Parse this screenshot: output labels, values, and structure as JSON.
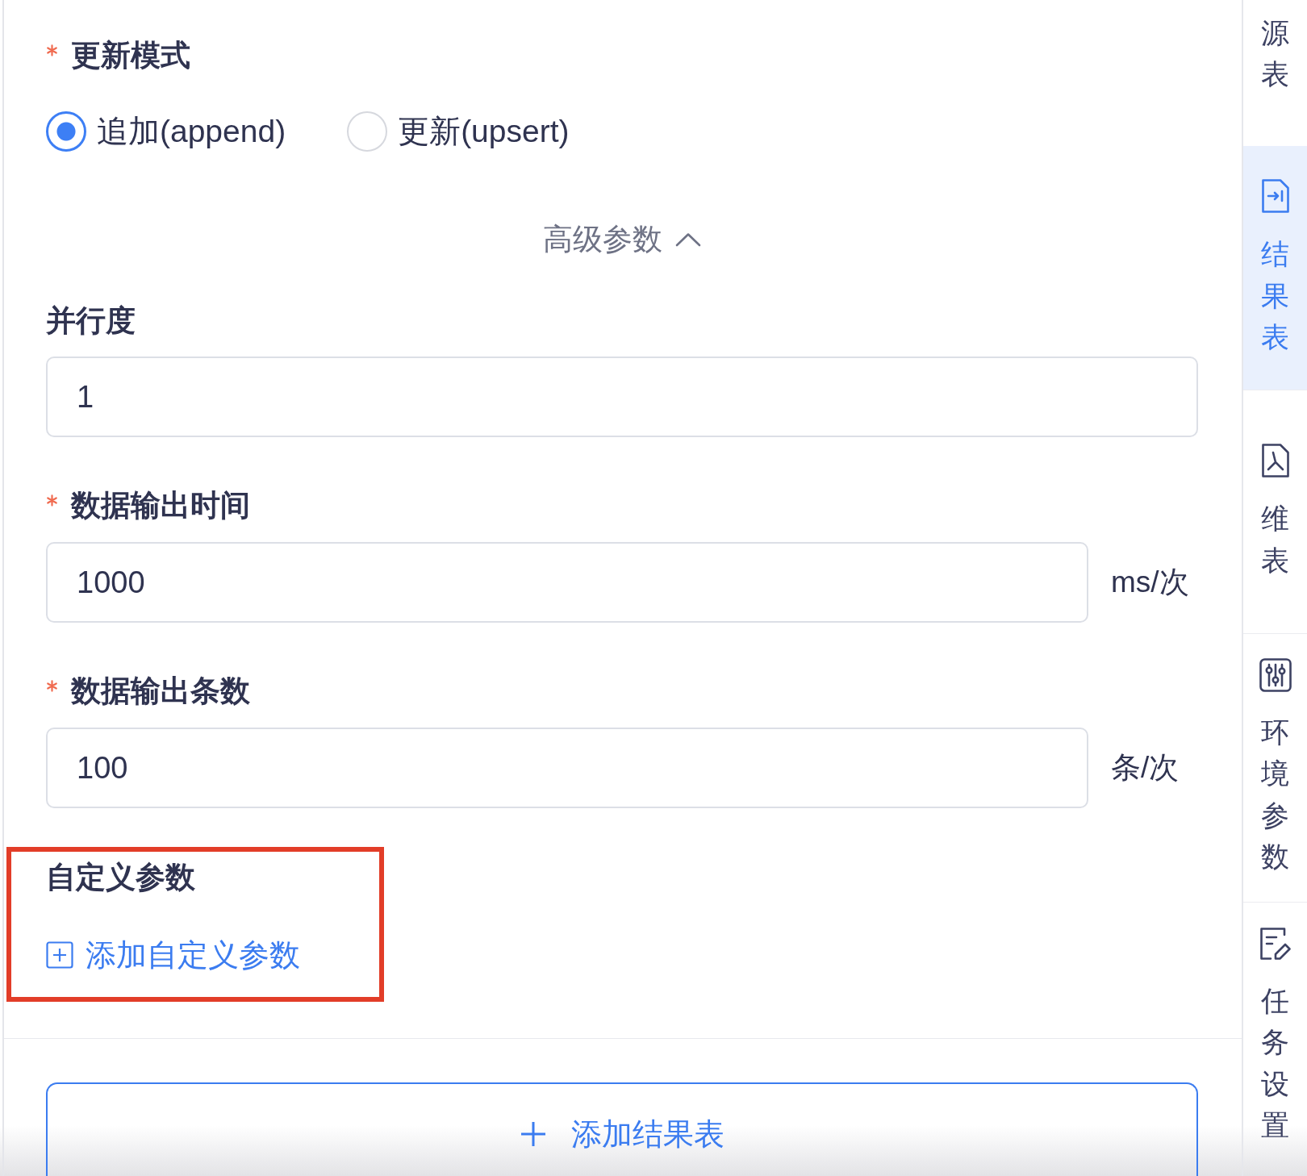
{
  "form": {
    "update_mode": {
      "label": "更新模式",
      "required": true,
      "options": [
        {
          "label": "追加(append)",
          "selected": true
        },
        {
          "label": "更新(upsert)",
          "selected": false
        }
      ]
    },
    "advanced": {
      "label": "高级参数",
      "expanded": true
    },
    "fields": [
      {
        "label": "并行度",
        "required": false,
        "value": "1"
      },
      {
        "label": "数据输出时间",
        "required": true,
        "value": "1000",
        "unit": "ms/次"
      },
      {
        "label": "数据输出条数",
        "required": true,
        "value": "100",
        "unit": "条/次"
      }
    ],
    "custom_params": {
      "label": "自定义参数",
      "add_label": "添加自定义参数",
      "highlighted": true
    },
    "add_button": {
      "label": "添加结果表"
    }
  },
  "sidebar": {
    "items": [
      {
        "label": "源表",
        "selected": false
      },
      {
        "label": "结果表",
        "selected": true
      },
      {
        "label": "维表",
        "selected": false
      },
      {
        "label": "环境参数",
        "selected": false
      },
      {
        "label": "任务设置",
        "selected": false
      }
    ]
  }
}
